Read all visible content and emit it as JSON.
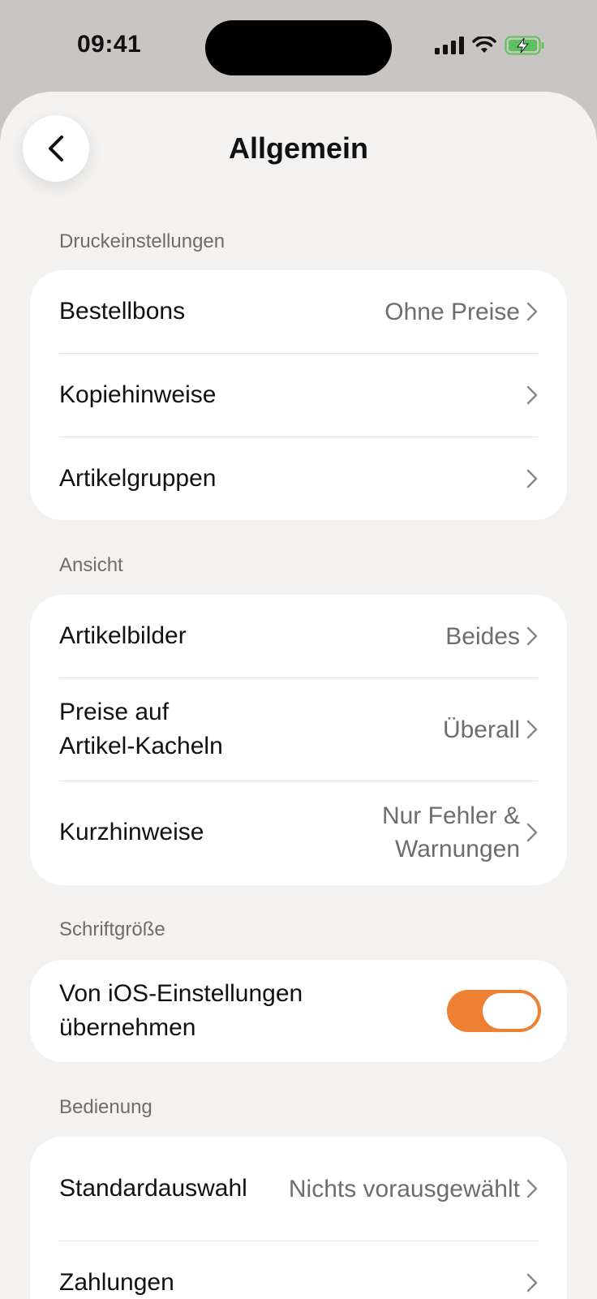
{
  "status": {
    "time": "09:41"
  },
  "header": {
    "title": "Allgemein"
  },
  "sections": {
    "print": {
      "label": "Druckeinstellungen",
      "rows": [
        {
          "label": "Bestellbons",
          "value": "Ohne Preise"
        },
        {
          "label": "Kopiehinweise",
          "value": ""
        },
        {
          "label": "Artikelgruppen",
          "value": ""
        }
      ]
    },
    "view": {
      "label": "Ansicht",
      "rows": [
        {
          "label": "Artikelbilder",
          "value": "Beides"
        },
        {
          "label_line1": "Preise auf",
          "label_line2": "Artikel-Kacheln",
          "value": "Überall"
        },
        {
          "label": "Kurzhinweise",
          "value_line1": "Nur Fehler &",
          "value_line2": "Warnungen"
        }
      ]
    },
    "font": {
      "label": "Schriftgröße",
      "toggle_row": {
        "label_line1": "Von iOS-Einstellungen",
        "label_line2": "übernehmen",
        "enabled": true
      }
    },
    "operation": {
      "label": "Bedienung",
      "rows": [
        {
          "label": "Standardauswahl",
          "value": "Nichts vorausgewählt"
        },
        {
          "label": "Zahlungen",
          "value": ""
        }
      ]
    }
  },
  "colors": {
    "accent": "#ee8033",
    "background": "#f3f2f1",
    "card": "#ffffff",
    "secondary_text": "#6f6c6a"
  },
  "icons": [
    "back-chevron-icon",
    "chevron-right-icon",
    "signal-icon",
    "wifi-icon",
    "battery-charging-icon"
  ]
}
